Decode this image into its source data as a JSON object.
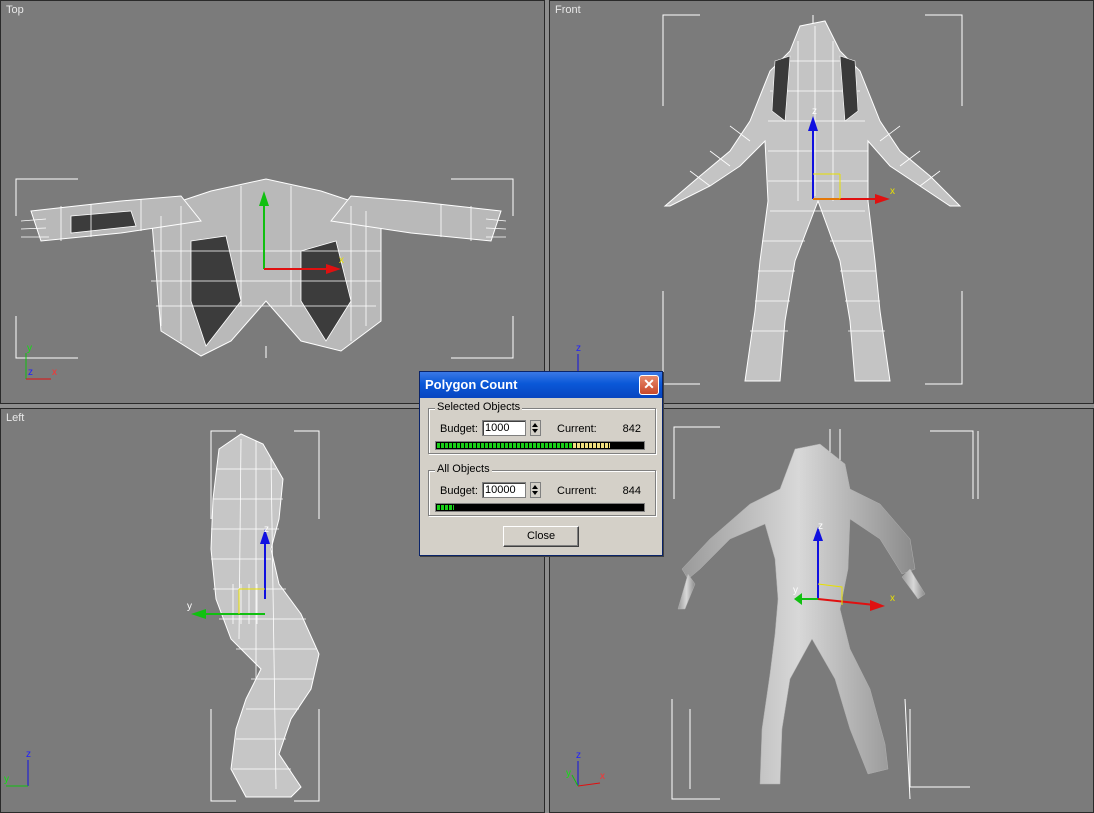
{
  "viewports": {
    "top": {
      "label": "Top",
      "axis_a": "y",
      "axis_b": "x",
      "axis_c": "z",
      "gizmo_x": "x"
    },
    "front": {
      "label": "Front",
      "axis_a": "z",
      "gizmo_x": "x",
      "gizmo_z": "z"
    },
    "left": {
      "label": "Left",
      "axis_a": "z",
      "axis_b": "y",
      "gizmo_y": "y",
      "gizmo_z": "z"
    },
    "perspective": {
      "gizmo_x": "x",
      "gizmo_y": "y",
      "gizmo_z": "z",
      "axis_a": "z",
      "axis_b": "x",
      "axis_c": "y"
    }
  },
  "dialog": {
    "title": "Polygon Count",
    "selected": {
      "group_title": "Selected Objects",
      "budget_label": "Budget:",
      "budget_value": "1000",
      "current_label": "Current:",
      "current_value": "842",
      "fraction": 0.842
    },
    "all": {
      "group_title": "All Objects",
      "budget_label": "Budget:",
      "budget_value": "10000",
      "current_label": "Current:",
      "current_value": "844",
      "fraction": 0.0844
    },
    "close_label": "Close"
  },
  "colors": {
    "viewport_bg": "#7b7b7b",
    "wire": "#ffffff",
    "axis_x": "#e01010",
    "axis_y": "#10c010",
    "axis_z": "#1010e0",
    "titlebar": "#0a58d8"
  }
}
